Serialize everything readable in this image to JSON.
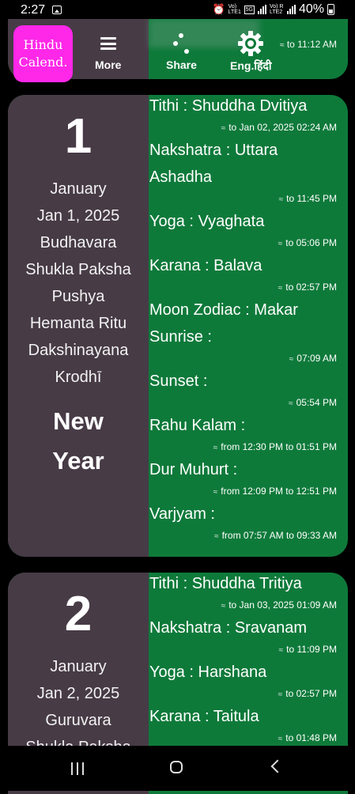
{
  "status": {
    "time": "2:27",
    "carrier1": "Vo) LTE1",
    "net": "5G",
    "carrier2": "Vo) R LTE2",
    "battery": "40%"
  },
  "toolbar": {
    "logo_line1": "Hindu",
    "logo_line2": "Calend.",
    "more_label": "More",
    "share_label": "Share",
    "lang_label": "Eng.हिंदी",
    "prev_partial_text": "to 11:12 AM"
  },
  "days": [
    {
      "day": "1",
      "month": "January",
      "date": "Jan 1, 2025",
      "weekday": "Budhavara",
      "paksha": "Shukla Paksha",
      "nakshatra_short": "Pushya",
      "ritu": "Hemanta Ritu",
      "ayana": "Dakshinayana",
      "samvat": "Krodhī",
      "festival_line1": "New",
      "festival_line2": "Year",
      "tithi": "Tithi : Shuddha Dvitiya",
      "tithi_to": "to Jan 02, 2025 02:24 AM",
      "nakshatra_line1": "Nakshatra : Uttara",
      "nakshatra_line2": "Ashadha",
      "nakshatra_to": "to 11:45 PM",
      "yoga": "Yoga : Vyaghata",
      "yoga_to": "to 05:06 PM",
      "karana": "Karana : Balava",
      "karana_to": "to 02:57 PM",
      "moon_zodiac": "Moon Zodiac : Makar",
      "sunrise": "Sunrise :",
      "sunrise_time": "07:09 AM",
      "sunset": "Sunset :",
      "sunset_time": "05:54 PM",
      "rahu": "Rahu Kalam :",
      "rahu_time": "from 12:30 PM to 01:51 PM",
      "dur": "Dur Muhurt :",
      "dur_time": "from 12:09 PM to 12:51 PM",
      "varjyam": "Varjyam :",
      "varjyam_time": "from 07:57 AM to 09:33 AM"
    },
    {
      "day": "2",
      "month": "January",
      "date": "Jan 2, 2025",
      "weekday": "Guruvara",
      "paksha": "Shukla Paksha",
      "tithi": "Tithi : Shuddha Tritiya",
      "tithi_to": "to Jan 03, 2025 01:09 AM",
      "nakshatra": "Nakshatra : Sravanam",
      "nakshatra_to": "to 11:09 PM",
      "yoga": "Yoga : Harshana",
      "yoga_to": "to 02:57 PM",
      "karana": "Karana : Taitula",
      "karana_to": "to 01:48 PM"
    }
  ],
  "approx_symbol": "≈",
  "colors": {
    "green": "#0e7a3a",
    "panel": "#473b46",
    "logo": "#ff27e8"
  }
}
